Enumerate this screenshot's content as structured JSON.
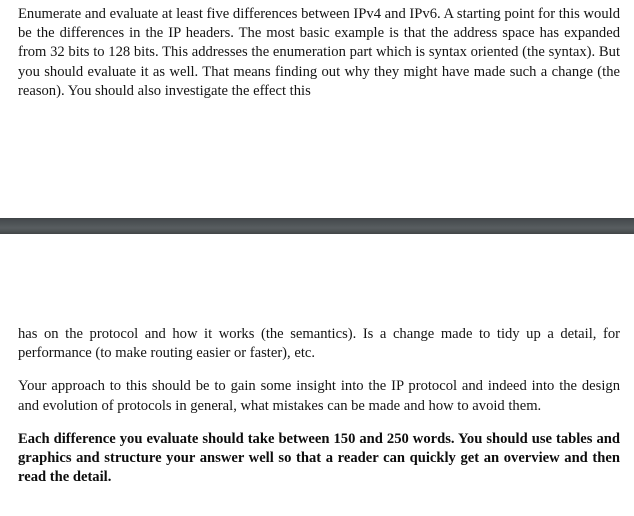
{
  "document": {
    "type": "assignment-brief",
    "colors": {
      "page_background": "#ffffff",
      "text": "#141414",
      "divider_bar": "#53585b"
    },
    "sections": {
      "top": {
        "paragraphs": [
          {
            "id": "intro",
            "bold": false,
            "text": "Enumerate and evaluate at least five differences between IPv4 and IPv6. A starting point for this would be the differences in the IP headers. The most basic example is that the address space has expanded from 32 bits to 128 bits. This addresses the enumeration part which is syntax oriented (the syntax). But you should evaluate it as well. That means finding out why they might have made such a change (the reason). You should also investigate the effect this"
          }
        ]
      },
      "divider": {
        "name": "page-break-bar",
        "label": ""
      },
      "bottom": {
        "paragraphs": [
          {
            "id": "semantics",
            "bold": false,
            "text": "has on the protocol and how it works (the semantics). Is a change made to tidy up a detail, for performance (to make routing easier or faster), etc."
          },
          {
            "id": "approach",
            "bold": false,
            "text": "Your approach to this should be to gain some insight into the IP protocol and indeed into the design and evolution of protocols in general, what mistakes can be made and how to avoid them."
          },
          {
            "id": "requirements",
            "bold": true,
            "text": "Each difference you evaluate should take between 150 and 250 words. You should use tables and graphics and structure your answer well so that a reader can quickly get an overview and then read the detail."
          }
        ]
      }
    }
  }
}
